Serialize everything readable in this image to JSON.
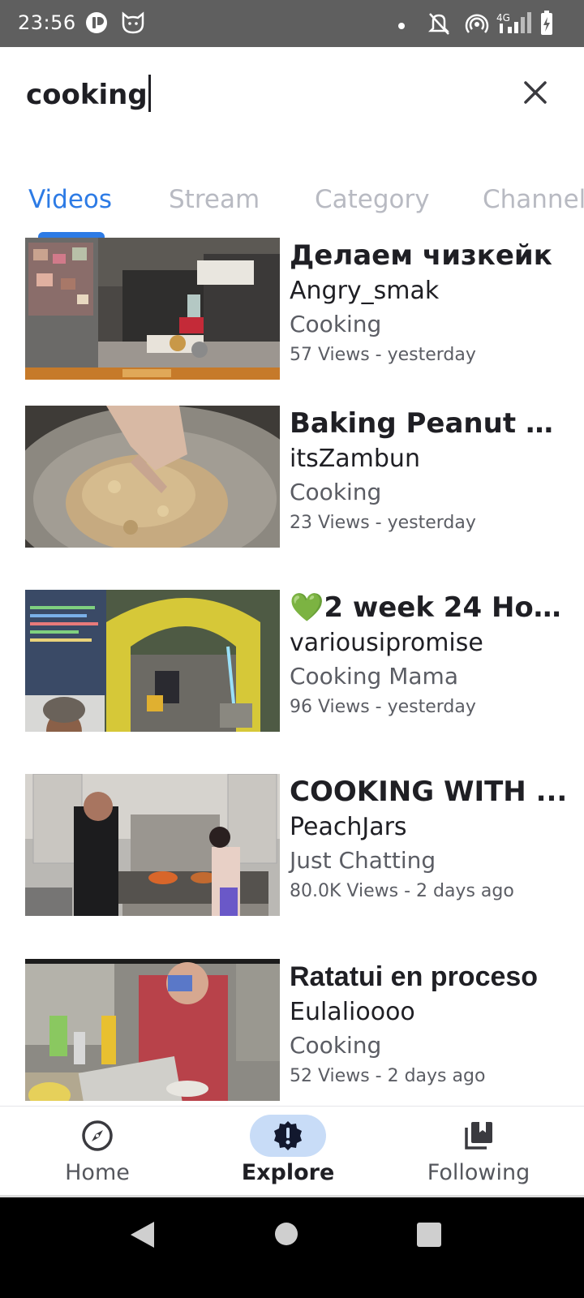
{
  "status_bar": {
    "time": "23:56",
    "icons": [
      "app-notification-icon",
      "cat-notification-icon",
      "dot-icon",
      "mute-icon",
      "hotspot-icon",
      "signal-4g-icon",
      "battery-charging-icon"
    ],
    "network_label": "4G"
  },
  "search": {
    "query": "cooking",
    "clear_icon": "close-icon"
  },
  "tabs": [
    "Videos",
    "Stream",
    "Category",
    "Channels"
  ],
  "active_tab": "Videos",
  "colors": {
    "accent": "#2d7be5",
    "active_nav_pill": "#c8dcf7",
    "inactive_tab": "#b8bac2"
  },
  "videos": [
    {
      "title": "Делаем чизкейк",
      "channel": "Angry_smak",
      "category": "Cooking",
      "stats": "57 Views - yesterday"
    },
    {
      "title": "Baking Peanut B...",
      "channel": "itsZambun",
      "category": "Cooking",
      "stats": "23 Views - yesterday"
    },
    {
      "title": "💚2 week 24 Hou...",
      "channel": "variousipromise",
      "category": "Cooking Mama",
      "stats": "96 Views - yesterday"
    },
    {
      "title": "COOKING WITH ...",
      "channel": "PeachJars",
      "category": "Just Chatting",
      "stats": "80.0K Views - 2 days ago"
    },
    {
      "title": "Ratatui en proceso",
      "channel": "Eulalioooo",
      "category": "Cooking",
      "stats": "52 Views - 2 days ago"
    }
  ],
  "bottom_nav": [
    {
      "label": "Home",
      "icon": "compass-icon"
    },
    {
      "label": "Explore",
      "icon": "explore-alert-icon"
    },
    {
      "label": "Following",
      "icon": "library-bookmark-icon"
    }
  ],
  "active_nav": "Explore",
  "system_nav": [
    "back-icon",
    "home-circle-icon",
    "recents-square-icon"
  ]
}
